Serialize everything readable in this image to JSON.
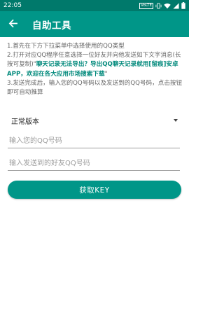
{
  "status_bar": {
    "time": "22:05",
    "icons": [
      "volte-icon",
      "vibrate-icon",
      "wifi-icon",
      "signal-icon",
      "battery-icon"
    ],
    "volte_label": "VoLTE"
  },
  "app_bar": {
    "title": "自助工具",
    "back_icon": "arrow-left-icon"
  },
  "instructions": {
    "line1": "1.首先在下方下拉菜单中选择使用的QQ类型",
    "line2": "2.打开对应QQ程序任意选择一位好友并向他发送如下文字消息(长按可复制)\"",
    "highlight": "聊天记录无法导出？导出QQ聊天记录就用[留痕]安卓APP，欢迎在各大应用市场搜索下载",
    "line2_end": "\"",
    "line3": "3.发送完成后，输入您的QQ号码以及发送到的QQ号码，点击按钮即可自动推算"
  },
  "version_select": {
    "selected": "正常版本"
  },
  "inputs": {
    "my_qq_placeholder": "输入您的QQ号码",
    "friend_qq_placeholder": "输入发送到的好友QQ号码"
  },
  "actions": {
    "get_key_label": "获取KEY"
  },
  "colors": {
    "status_bar": "#00796b",
    "app_bar": "#009688",
    "accent": "#009688",
    "highlight_text": "#00897b"
  }
}
